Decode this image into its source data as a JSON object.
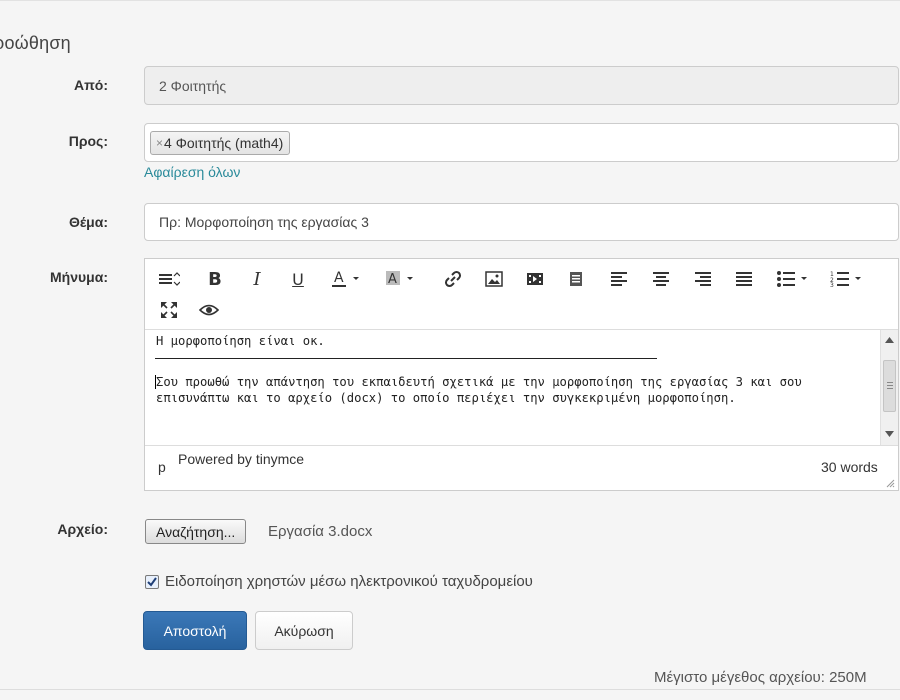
{
  "page": {
    "title": "ροώθηση"
  },
  "form": {
    "from": {
      "label": "Από:",
      "value": "2 Φοιτητής"
    },
    "to": {
      "label": "Προς:",
      "tag_remove": "×",
      "tag": "4 Φοιτητής (math4)",
      "remove_all": "Αφαίρεση όλων"
    },
    "subject": {
      "label": "Θέμα:",
      "value": "Πρ: Μορφοποίηση της εργασίας 3"
    },
    "message": {
      "label": "Μήνυμα:",
      "lines": [
        "Η μορφοποίηση είναι οκ.",
        "Σου προωθώ την απάντηση του εκπαιδευτή σχετικά με την μορφοποίηση  της εργασίας 3 και σου",
        "επισυνάπτω και το αρχείο (docx) το οποίο περιέχει την συγκεκριμένη μορφοποίηση."
      ],
      "path": "p",
      "powered": "Powered by tinymce",
      "word_count": "30 words"
    },
    "file": {
      "label": "Αρχείο:",
      "button": "Αναζήτηση...",
      "filename": "Εργασία 3.docx"
    },
    "notify": {
      "label": "Ειδοποίηση χρηστών μέσω ηλεκτρονικού ταχυδρομείου",
      "checked": true
    },
    "buttons": {
      "send": "Αποστολή",
      "cancel": "Ακύρωση"
    },
    "max_size": "Μέγιστο μέγεθος αρχείου: 250M"
  },
  "colors": {
    "primary": "#2d6aa8",
    "link": "#2a8a9a",
    "background": "#f5f5f5"
  }
}
